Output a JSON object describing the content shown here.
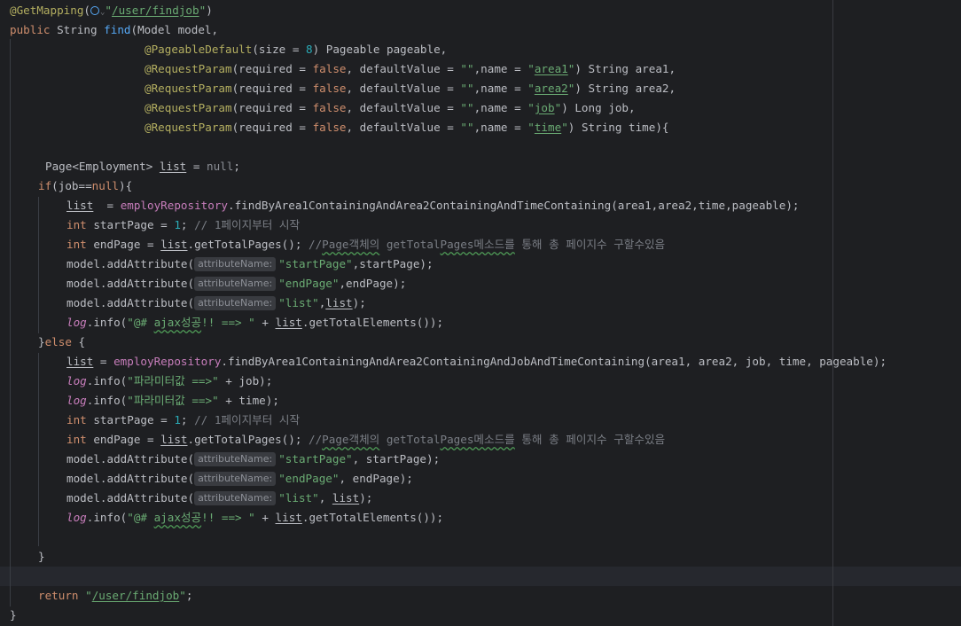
{
  "editor": {
    "route_path": "/user/findjob",
    "hint_label": "attributeName:",
    "icon": "globe-icon",
    "colors": {
      "background": "#1e1f22",
      "keyword": "#cf8e6d",
      "annotation": "#b3ae60",
      "string": "#6aab73",
      "number": "#2aacb8",
      "comment": "#7a7e85",
      "field": "#c77dbb",
      "method": "#56a8f5"
    },
    "lines": {
      "l1": "@GetMapping(",
      "l1b": "\"/user/findjob\")",
      "l2": "public String find(Model model,",
      "l3": "@PageableDefault(size = 8) Pageable pageable,",
      "l4": "@RequestParam(required = false, defaultValue = \"\",name = \"area1\") String area1,",
      "l5": "@RequestParam(required = false, defaultValue = \"\",name = \"area2\") String area2,",
      "l6": "@RequestParam(required = false, defaultValue = \"\",name = \"job\") Long job,",
      "l7": "@RequestParam(required = false, defaultValue = \"\",name = \"time\") String time){",
      "l8": "Page<Employment> list = null;",
      "l9": "if(job==null){",
      "l10": "list  = employRepository.findByArea1ContainingAndArea2ContainingAndTimeContaining(area1,area2,time,pageable);",
      "l11": "int startPage = 1; // 1페이지부터 시작",
      "l12": "int endPage = list.getTotalPages(); //Page객체의 getTotalPages메소드를 통해 총 페이지수 구할수있음",
      "l13": "model.addAttribute(\"startPage\",startPage);",
      "l14": "model.addAttribute(\"endPage\",endPage);",
      "l15": "model.addAttribute(\"list\",list);",
      "l16": "log.info(\"@# ajax성공!! ==> \" + list.getTotalElements());",
      "l17": "}else {",
      "l18": "list = employRepository.findByArea1ContainingAndArea2ContainingAndJobAndTimeContaining(area1, area2, job, time, pageable);",
      "l19": "log.info(\"파라미터값 ==>\" + job);",
      "l20": "log.info(\"파라미터값 ==>\" + time);",
      "l21": "int startPage = 1; // 1페이지부터 시작",
      "l22": "int endPage = list.getTotalPages(); //Page객체의 getTotalPages메소드를 통해 총 페이지수 구할수있음",
      "l23": "model.addAttribute(\"startPage\", startPage);",
      "l24": "model.addAttribute(\"endPage\", endPage);",
      "l25": "model.addAttribute(\"list\", list);",
      "l26": "log.info(\"@# ajax성공!! ==> \" + list.getTotalElements());",
      "l27": "}",
      "l28": "return \"/user/findjob\";",
      "l29": "}"
    }
  }
}
